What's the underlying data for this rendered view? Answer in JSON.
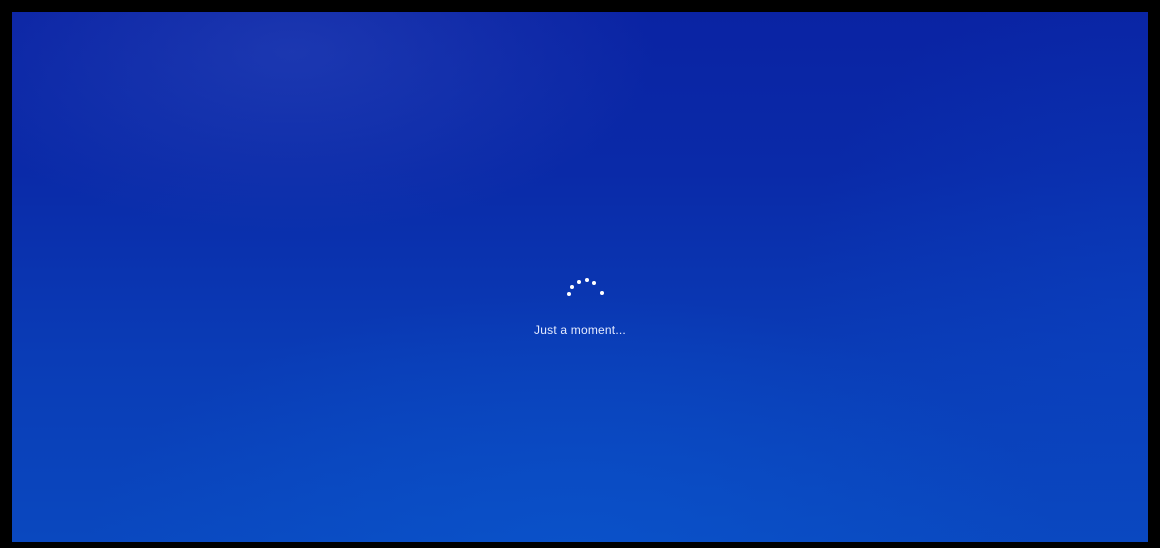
{
  "screen": {
    "message": "Just a moment...",
    "loading_icon": "spinning-dots-icon",
    "colors": {
      "background": "#0a2aa8",
      "frame": "#000000",
      "text": "#e6ecff",
      "dots": "#ffffff"
    }
  }
}
